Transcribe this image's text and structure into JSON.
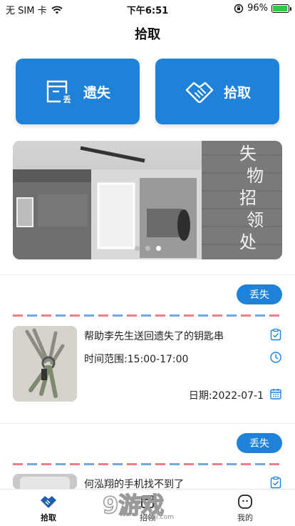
{
  "status_bar": {
    "carrier": "无 SIM 卡",
    "time": "下午6:51",
    "battery_text": "96%",
    "battery_level": 0.96
  },
  "header": {
    "title": "拾取"
  },
  "actions": {
    "lost_label": "遗失",
    "lost_icon_text": "丢",
    "found_label": "拾取"
  },
  "banner": {
    "sign_text": [
      "失",
      "物",
      "招",
      "领",
      "处"
    ],
    "slide_count": 3,
    "active_slide": 2
  },
  "posts": [
    {
      "tag": "丢失",
      "title": "帮助李先生送回遗失了的钥匙串",
      "time_range": "时间范围:15:00-17:00",
      "date": "日期:2022-07-1"
    },
    {
      "tag": "丢失",
      "title": "何泓翔的手机找不到了"
    }
  ],
  "tab_bar": {
    "items": [
      {
        "label": "拾取",
        "icon": "handshake-icon",
        "active": true
      },
      {
        "label": "招领",
        "icon": "box-icon",
        "active": false
      },
      {
        "label": "我的",
        "icon": "face-icon",
        "active": false
      }
    ]
  },
  "watermark": {
    "text": "9游戏",
    "sub": "danji.com"
  },
  "colors": {
    "primary": "#2081d8",
    "airmail_red": "#e87f8a",
    "airmail_blue": "#6fa8e6"
  }
}
